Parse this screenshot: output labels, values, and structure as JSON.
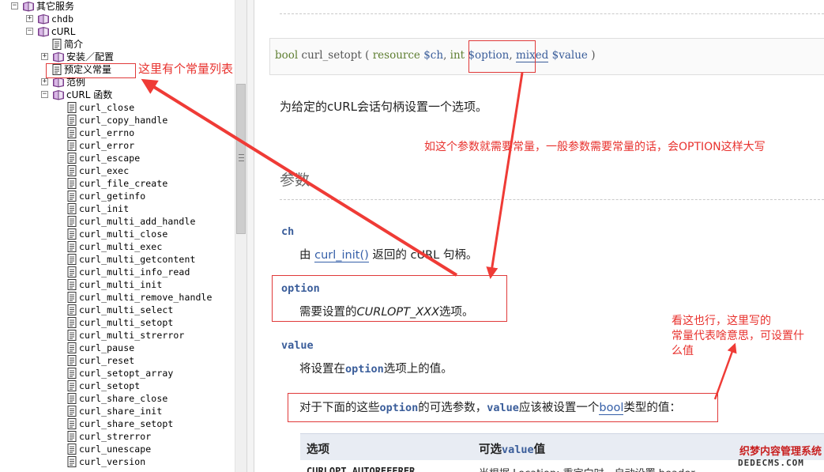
{
  "tree": {
    "items": [
      {
        "label": "其它服务",
        "kind": "book",
        "depth": 0,
        "toggle": "−"
      },
      {
        "label": "chdb",
        "kind": "book",
        "depth": 1,
        "toggle": "+"
      },
      {
        "label": "cURL",
        "kind": "book",
        "depth": 1,
        "toggle": "−"
      },
      {
        "label": "简介",
        "kind": "page",
        "depth": 2,
        "toggle": ""
      },
      {
        "label": "安装／配置",
        "kind": "book",
        "depth": 2,
        "toggle": "+"
      },
      {
        "label": "预定义常量",
        "kind": "page",
        "depth": 2,
        "toggle": ""
      },
      {
        "label": "范例",
        "kind": "book",
        "depth": 2,
        "toggle": "+"
      },
      {
        "label": "cURL 函数",
        "kind": "book",
        "depth": 2,
        "toggle": "−"
      },
      {
        "label": "curl_close",
        "kind": "page",
        "depth": 3,
        "toggle": ""
      },
      {
        "label": "curl_copy_handle",
        "kind": "page",
        "depth": 3,
        "toggle": ""
      },
      {
        "label": "curl_errno",
        "kind": "page",
        "depth": 3,
        "toggle": ""
      },
      {
        "label": "curl_error",
        "kind": "page",
        "depth": 3,
        "toggle": ""
      },
      {
        "label": "curl_escape",
        "kind": "page",
        "depth": 3,
        "toggle": ""
      },
      {
        "label": "curl_exec",
        "kind": "page",
        "depth": 3,
        "toggle": ""
      },
      {
        "label": "curl_file_create",
        "kind": "page",
        "depth": 3,
        "toggle": ""
      },
      {
        "label": "curl_getinfo",
        "kind": "page",
        "depth": 3,
        "toggle": ""
      },
      {
        "label": "curl_init",
        "kind": "page",
        "depth": 3,
        "toggle": ""
      },
      {
        "label": "curl_multi_add_handle",
        "kind": "page",
        "depth": 3,
        "toggle": ""
      },
      {
        "label": "curl_multi_close",
        "kind": "page",
        "depth": 3,
        "toggle": ""
      },
      {
        "label": "curl_multi_exec",
        "kind": "page",
        "depth": 3,
        "toggle": ""
      },
      {
        "label": "curl_multi_getcontent",
        "kind": "page",
        "depth": 3,
        "toggle": ""
      },
      {
        "label": "curl_multi_info_read",
        "kind": "page",
        "depth": 3,
        "toggle": ""
      },
      {
        "label": "curl_multi_init",
        "kind": "page",
        "depth": 3,
        "toggle": ""
      },
      {
        "label": "curl_multi_remove_handle",
        "kind": "page",
        "depth": 3,
        "toggle": ""
      },
      {
        "label": "curl_multi_select",
        "kind": "page",
        "depth": 3,
        "toggle": ""
      },
      {
        "label": "curl_multi_setopt",
        "kind": "page",
        "depth": 3,
        "toggle": ""
      },
      {
        "label": "curl_multi_strerror",
        "kind": "page",
        "depth": 3,
        "toggle": ""
      },
      {
        "label": "curl_pause",
        "kind": "page",
        "depth": 3,
        "toggle": ""
      },
      {
        "label": "curl_reset",
        "kind": "page",
        "depth": 3,
        "toggle": ""
      },
      {
        "label": "curl_setopt_array",
        "kind": "page",
        "depth": 3,
        "toggle": ""
      },
      {
        "label": "curl_setopt",
        "kind": "page",
        "depth": 3,
        "toggle": ""
      },
      {
        "label": "curl_share_close",
        "kind": "page",
        "depth": 3,
        "toggle": ""
      },
      {
        "label": "curl_share_init",
        "kind": "page",
        "depth": 3,
        "toggle": ""
      },
      {
        "label": "curl_share_setopt",
        "kind": "page",
        "depth": 3,
        "toggle": ""
      },
      {
        "label": "curl_strerror",
        "kind": "page",
        "depth": 3,
        "toggle": ""
      },
      {
        "label": "curl_unescape",
        "kind": "page",
        "depth": 3,
        "toggle": ""
      },
      {
        "label": "curl_version",
        "kind": "page",
        "depth": 3,
        "toggle": ""
      }
    ]
  },
  "doc": {
    "synopsis": {
      "ret_type": "bool",
      "func": "curl_setopt",
      "open": "(",
      "p1_type": "resource",
      "p1_var": "$ch",
      "comma1": ",",
      "p2_type": "int",
      "p2_var": "$option",
      "comma2": ",",
      "p3_type": "mixed",
      "p3_var": "$value",
      "close": ")"
    },
    "description": "为给定的cURL会话句柄设置一个选项。",
    "params_heading": "参数",
    "params": {
      "ch_name": "ch",
      "ch_pre": "由",
      "ch_link": "curl_init()",
      "ch_post": "返回的 cURL 句柄。",
      "option_name": "option",
      "option_pre": "需要设置的",
      "option_const": "CURLOPT_XXX",
      "option_post": "选项。",
      "value_name": "value",
      "value_pre": "将设置在",
      "value_code": "option",
      "value_post": "选项上的值。"
    },
    "note": {
      "pre": "对于下面的这些",
      "code1": "option",
      "mid": "的可选参数，",
      "code2": "value",
      "mid2": "应该被设置一个",
      "link": "bool",
      "post": "类型的值："
    },
    "table": {
      "h1": "选项",
      "h2_pre": "可选",
      "h2_code": "value",
      "h2_post": "值",
      "r1_name": "CURLOPT_AUTOREFERER",
      "r1_value": "当根据 Location: 重定向时，自动设置 header"
    }
  },
  "annotations": {
    "a1": "这里有个常量列表",
    "a2": "如这个参数就需要常量，一般参数需要常量的话，会OPTION这样大写",
    "a3_l1": "看这也行，这里写的",
    "a3_l2": "常量代表啥意思，可设置什",
    "a3_l3": "么值"
  },
  "watermark": {
    "top": "织梦内容管理系统",
    "bottom": "DEDECMS.COM"
  },
  "colors": {
    "annotation": "#e8322e",
    "param": "#3a5d9a",
    "book": "#7a3d8c"
  }
}
